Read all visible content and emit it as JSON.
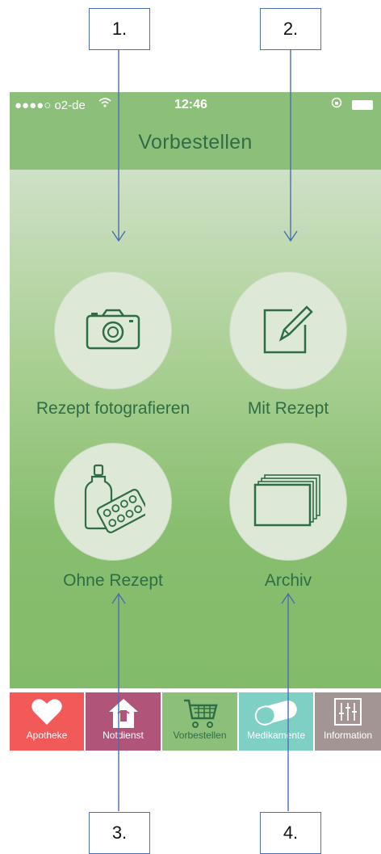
{
  "callouts": [
    "1.",
    "2.",
    "3.",
    "4."
  ],
  "status": {
    "carrier": "●●●●○ o2-de",
    "time": "12:46"
  },
  "header": {
    "title": "Vorbestellen"
  },
  "actions": [
    {
      "label": "Rezept fotografieren",
      "icon": "camera-icon"
    },
    {
      "label": "Mit Rezept",
      "icon": "pencil-edit-icon"
    },
    {
      "label": "Ohne Rezept",
      "icon": "medicine-bottle-pills-icon"
    },
    {
      "label": "Archiv",
      "icon": "stacked-cards-icon"
    }
  ],
  "tabs": [
    {
      "label": "Apotheke",
      "icon": "heart-icon",
      "color": "#f25a5a"
    },
    {
      "label": "Notdienst",
      "icon": "pharmacy-house-icon",
      "color": "#b0547a"
    },
    {
      "label": "Vorbestellen",
      "icon": "shopping-cart-icon",
      "color": "#8cc07a",
      "active": true
    },
    {
      "label": "Medikamente",
      "icon": "capsule-icon",
      "color": "#7ecfc4"
    },
    {
      "label": "Information",
      "icon": "sliders-icon",
      "color": "#a29593"
    }
  ],
  "colors": {
    "accent_green": "#8cc07a",
    "text_green": "#2f6e45",
    "callout_line": "#4a6fb0"
  }
}
